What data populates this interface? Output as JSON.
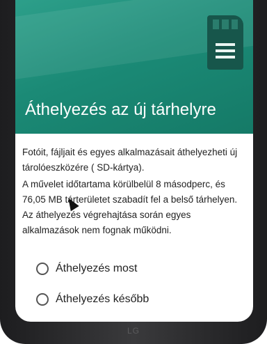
{
  "dialog": {
    "title": "Áthelyezés az új tárhelyre",
    "description_1": "Fotóit, fájljait és egyes alkalmazásait áthelyezheti új tárolóeszközére ( SD-kártya).",
    "description_2": "A művelet időtartama körülbelül 8 másodperc, és  76,05 MB tárterületet szabadít fel a belső tárhelyen. Az áthelyezés végrehajtása során egyes alkalmazások nem fognak működni.",
    "options": [
      {
        "label": "Áthelyezés most"
      },
      {
        "label": "Áthelyezés később"
      }
    ]
  },
  "header_icon": "sd-card-icon",
  "colors": {
    "header": "#1b8a76",
    "title_text": "#ffffff",
    "body_text": "#222222"
  }
}
